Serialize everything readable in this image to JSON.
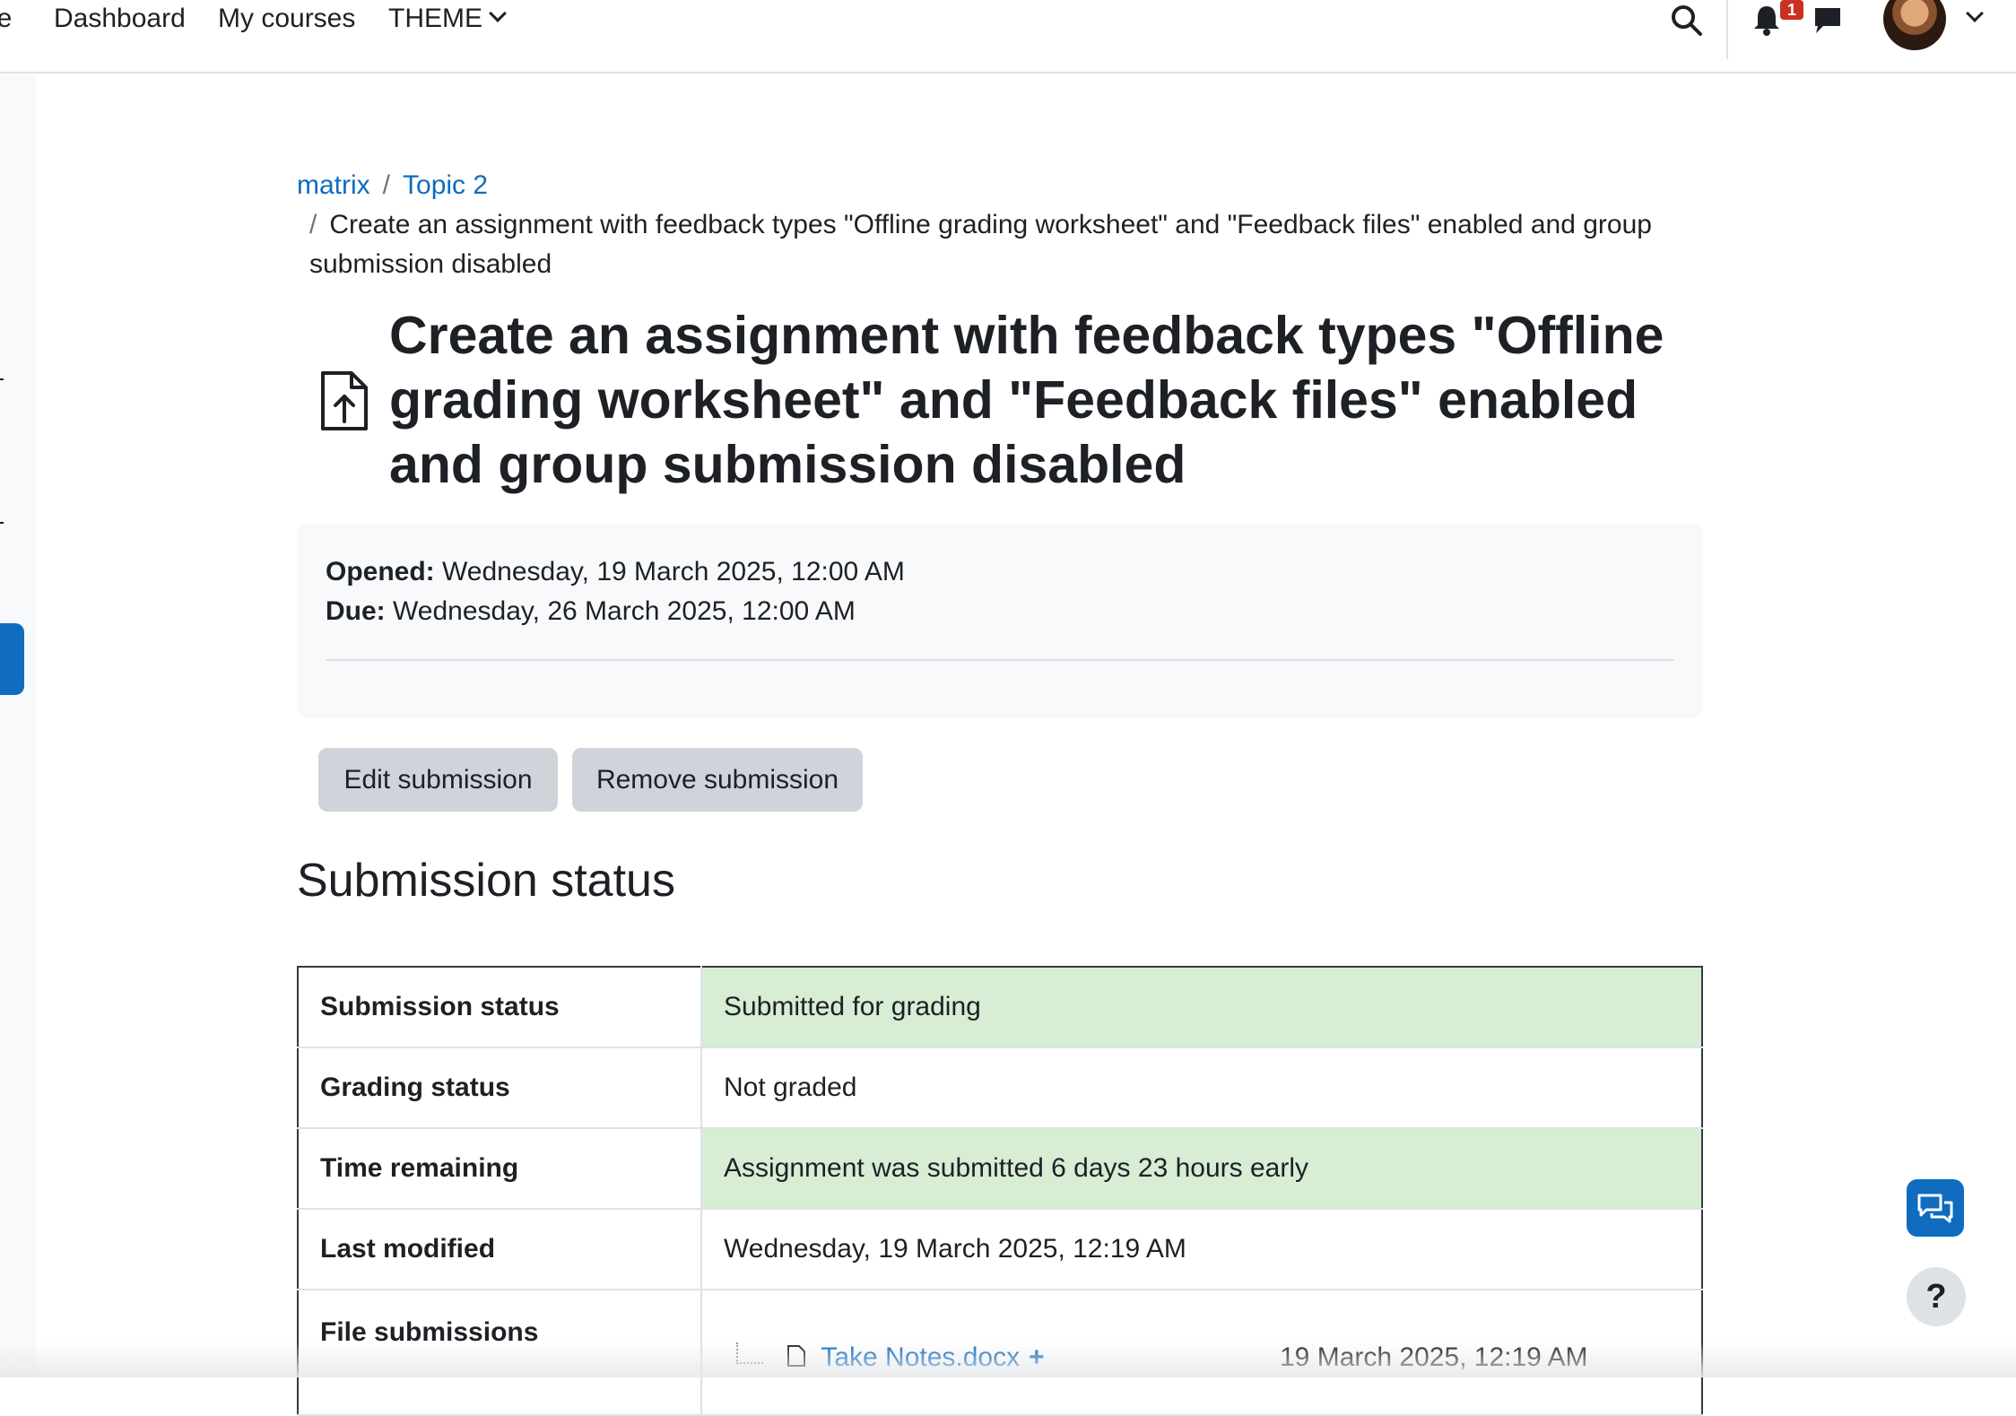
{
  "navbar": {
    "home_label": "ne",
    "dashboard_label": "Dashboard",
    "my_courses_label": "My courses",
    "theme_label": "THEME",
    "notification_count": "1",
    "icons": [
      "search-icon",
      "bell-icon",
      "message-icon",
      "avatar",
      "chevron-down-icon"
    ]
  },
  "breadcrumb": {
    "items": [
      "matrix",
      "Topic 2"
    ],
    "current": "Create an assignment with feedback types \"Offline grading worksheet\" and \"Feedback files\" enabled and group submission disabled"
  },
  "page": {
    "title": "Create an assignment with feedback types \"Offline grading worksheet\" and \"Feedback files\" enabled and group submission disabled",
    "activity_icon": "assignment-upload-icon"
  },
  "dates": {
    "opened_label": "Opened:",
    "opened_value": "Wednesday, 19 March 2025, 12:00 AM",
    "due_label": "Due:",
    "due_value": "Wednesday, 26 March 2025, 12:00 AM"
  },
  "actions": {
    "edit_label": "Edit submission",
    "remove_label": "Remove submission"
  },
  "submission": {
    "heading": "Submission status",
    "rows": [
      {
        "label": "Submission status",
        "value": "Submitted for grading"
      },
      {
        "label": "Grading status",
        "value": "Not graded"
      },
      {
        "label": "Time remaining",
        "value": "Assignment was submitted 6 days 23 hours early"
      },
      {
        "label": "Last modified",
        "value": "Wednesday, 19 March 2025, 12:19 AM"
      },
      {
        "label": "File submissions",
        "value": ""
      }
    ],
    "file": {
      "name": "Take Notes.docx",
      "plus": "+",
      "date": "19 March 2025, 12:19 AM"
    }
  },
  "colors": {
    "accent": "#0f6cbf",
    "success_bg": "#d7edd4",
    "badge": "#ca3120"
  },
  "floating": {
    "help_label": "?",
    "icons": [
      "chat-icon",
      "help-icon"
    ]
  }
}
